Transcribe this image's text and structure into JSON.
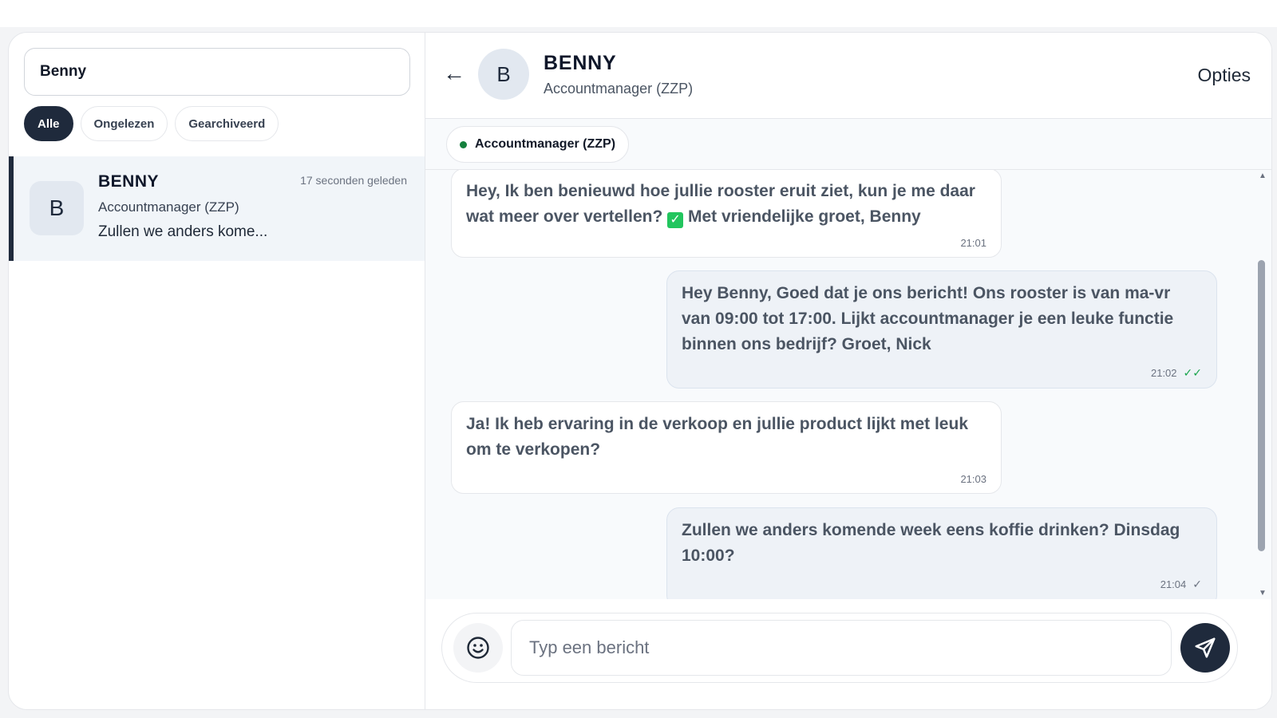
{
  "sidebar": {
    "search_value": "Benny",
    "filters": [
      {
        "label": "Alle",
        "active": true
      },
      {
        "label": "Ongelezen",
        "active": false
      },
      {
        "label": "Gearchiveerd",
        "active": false
      }
    ],
    "conversation": {
      "avatar_initial": "B",
      "name": "BENNY",
      "time": "17 seconden geleden",
      "role": "Accountmanager (ZZP)",
      "preview": "Zullen we anders kome..."
    }
  },
  "header": {
    "back_icon": "←",
    "avatar_initial": "B",
    "name": "BENNY",
    "role": "Accountmanager (ZZP)",
    "options_label": "Opties"
  },
  "context": {
    "label": "Accountmanager (ZZP)",
    "status_color": "#15803d"
  },
  "messages": [
    {
      "direction": "in",
      "text_before": "Hey, Ik ben benieuwd hoe jullie rooster eruit ziet, kun je me daar wat meer over vertellen?",
      "emoji": "✓",
      "text_after": " Met vriendelijke groet, Benny",
      "time": "21:01"
    },
    {
      "direction": "out",
      "text": "Hey Benny, Goed dat je ons bericht! Ons rooster is van ma-vr van 09:00 tot 17:00. Lijkt accountmanager je een leuke functie binnen ons bedrijf? Groet, Nick",
      "time": "21:02",
      "ticks": "✓✓"
    },
    {
      "direction": "in",
      "text": "Ja! Ik heb ervaring in de verkoop en jullie product lijkt met leuk om te verkopen?",
      "time": "21:03"
    },
    {
      "direction": "out",
      "text": "Zullen we anders komende week eens koffie drinken? Dinsdag 10:00?",
      "time": "21:04",
      "ticks": "✓"
    }
  ],
  "composer": {
    "placeholder": "Typ een bericht",
    "emoji_icon": "smiley-icon",
    "send_icon": "send-icon"
  },
  "colors": {
    "accent": "#1f2a3c",
    "read_ticks": "#16a34a"
  }
}
